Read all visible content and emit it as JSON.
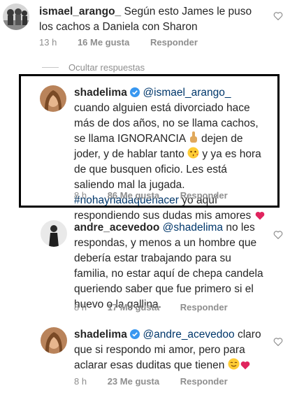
{
  "comment1": {
    "username": "ismael_arango_",
    "text": "Según esto James le puso los cachos a Daniela con Sharon",
    "time": "13 h",
    "likes": "16 Me gusta",
    "reply": "Responder"
  },
  "hide_replies": "Ocultar respuestas",
  "comment2": {
    "username": "shadelima",
    "verified_icon": "verified-badge-icon",
    "mention": "@ismael_arango_",
    "text1": "cuando alguien está divorciado hace más de dos años, no se llama cachos, se llama IGNORANCIA",
    "text2": "dejen de joder, y de hablar tanto",
    "text3": "y ya es hora de que busquen oficio. Les está saliendo mal la jugada.",
    "hashtag": "#nohaynadaquehacer",
    "text4": "yo aquí respondiendo sus dudas mis amores",
    "time": "8 h",
    "likes": "86 Me gusta",
    "reply": "Responder"
  },
  "comment3": {
    "username": "andre_acevedoo",
    "mention": "@shadelima",
    "text": "no les respondas, y menos a un hombre que debería estar trabajando para su familia, no estar aquí de chepa candela queriendo saber que fue primero si el huevo o la gallina.",
    "time": "8 h",
    "likes": "17 Me gusta",
    "reply": "Responder"
  },
  "comment4": {
    "username": "shadelima",
    "verified_icon": "verified-badge-icon",
    "mention": "@andre_acevedoo",
    "text": "claro que si respondo mi amor, pero para aclarar esas duditas que tienen",
    "time": "8 h",
    "likes": "23 Me gusta",
    "reply": "Responder"
  },
  "colors": {
    "text": "#262626",
    "muted": "#8e8e8e",
    "mention": "#00376b",
    "verified": "#3897f0",
    "emoji_heart": "#e0245e"
  }
}
